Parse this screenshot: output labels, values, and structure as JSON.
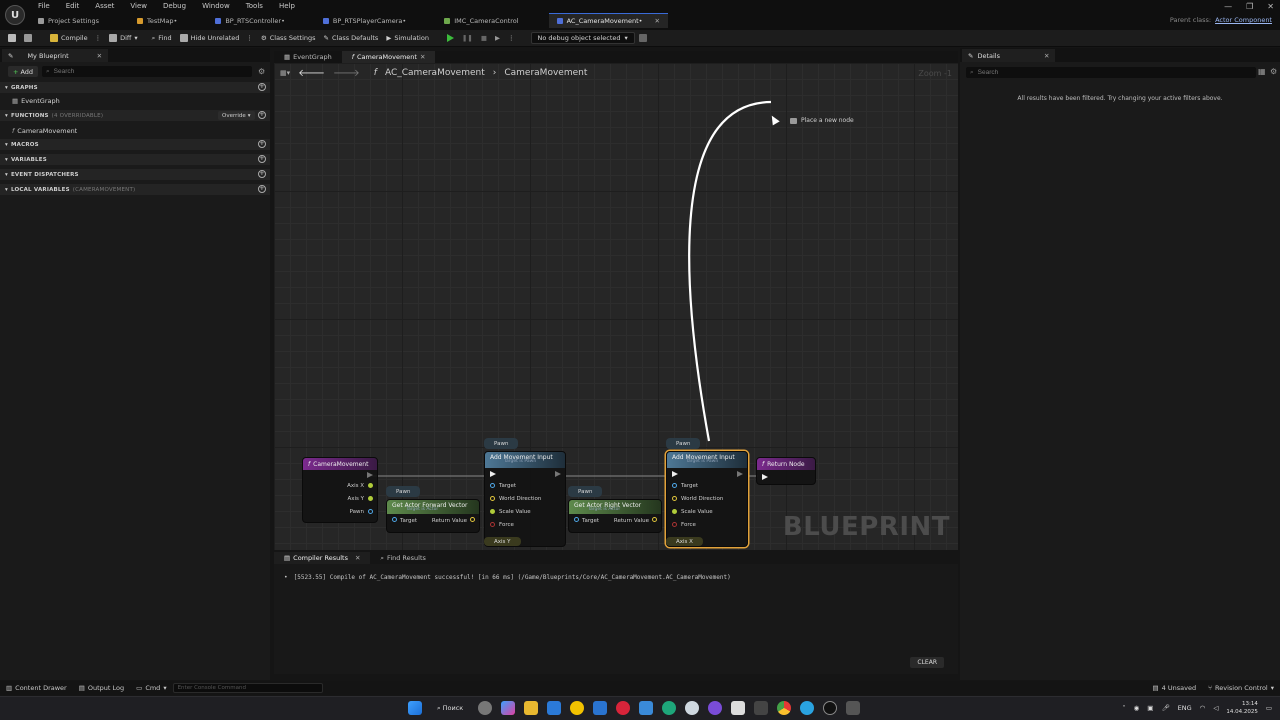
{
  "menu": [
    "File",
    "Edit",
    "Asset",
    "View",
    "Debug",
    "Window",
    "Tools",
    "Help"
  ],
  "tabs": [
    {
      "label": "Project Settings",
      "color": "#9a9a9a"
    },
    {
      "label": "TestMap•",
      "color": "#d69a2d"
    },
    {
      "label": "BP_RTSController•",
      "color": "#4f6fd8"
    },
    {
      "label": "BP_RTSPlayerCamera•",
      "color": "#4f6fd8"
    },
    {
      "label": "IMC_CameraControl",
      "color": "#6ea84c"
    },
    {
      "label": "AC_CameraMovement•",
      "color": "#4f6fd8"
    }
  ],
  "parent_class": {
    "label": "Parent class:",
    "value": "Actor Component"
  },
  "toolbar": {
    "compile": "Compile",
    "diff": "Diff",
    "find": "Find",
    "hide_unrelated": "Hide Unrelated",
    "class_settings": "Class Settings",
    "class_defaults": "Class Defaults",
    "simulation": "Simulation",
    "debug_object": "No debug object selected"
  },
  "my_blueprint": {
    "tab_label": "My Blueprint",
    "add_label": "Add",
    "search_placeholder": "Search",
    "graphs_header": "GRAPHS",
    "event_graph": "EventGraph",
    "functions_header": "FUNCTIONS",
    "functions_sub": "(4 OVERRIDABLE)",
    "override_label": "Override",
    "function_item": "CameraMovement",
    "macros_header": "MACROS",
    "variables_header": "VARIABLES",
    "dispatchers_header": "EVENT DISPATCHERS",
    "local_vars_header": "LOCAL VARIABLES",
    "local_vars_sub": "(CAMERAMOVEMENT)"
  },
  "graph_tabs": [
    "EventGraph",
    "CameraMovement"
  ],
  "breadcrumb": {
    "root": "AC_CameraMovement",
    "current": "CameraMovement"
  },
  "zoom_label": "Zoom -1",
  "watermark": "BLUEPRINT",
  "place_node_hint": "Place a new node",
  "nodes": {
    "entry": {
      "title": "CameraMovement",
      "pins": [
        "Axis X",
        "Axis Y",
        "Pawn"
      ]
    },
    "add_input_1": {
      "title": "Add Movement Input",
      "subtitle": "Target is Pawn",
      "pins": [
        "Target",
        "World Direction",
        "Scale Value",
        "Force"
      ]
    },
    "add_input_2": {
      "title": "Add Movement Input",
      "subtitle": "Target is Pawn",
      "pins": [
        "Target",
        "World Direction",
        "Scale Value",
        "Force"
      ]
    },
    "forward_vec": {
      "title": "Get Actor Forward Vector",
      "subtitle": "Target is Actor",
      "pin_in": "Target",
      "pin_out": "Return Value"
    },
    "right_vec": {
      "title": "Get Actor Right Vector",
      "subtitle": "Target is Actor",
      "pin_in": "Target",
      "pin_out": "Return Value"
    },
    "return": {
      "title": "Return Node"
    },
    "pawn_label": "Pawn",
    "axis_y": "Axis Y",
    "axis_x": "Axis X"
  },
  "bottom_tabs": [
    "Compiler Results",
    "Find Results"
  ],
  "compiler_message": "[5523.55] Compile of AC_CameraMovement successful! [in 66 ms] (/Game/Blueprints/Core/AC_CameraMovement.AC_CameraMovement)",
  "clear_label": "CLEAR",
  "details": {
    "tab_label": "Details",
    "search_placeholder": "Search",
    "filter_message": "All results have been filtered. Try changing your active filters above."
  },
  "statusbar": {
    "content_drawer": "Content Drawer",
    "output_log": "Output Log",
    "cmd": "Cmd",
    "console_placeholder": "Enter Console Command",
    "unsaved": "4 Unsaved",
    "revision_control": "Revision Control"
  },
  "taskbar": {
    "search": "Поиск",
    "lang": "ENG",
    "time": "13:14",
    "date": "14.04.2025"
  }
}
